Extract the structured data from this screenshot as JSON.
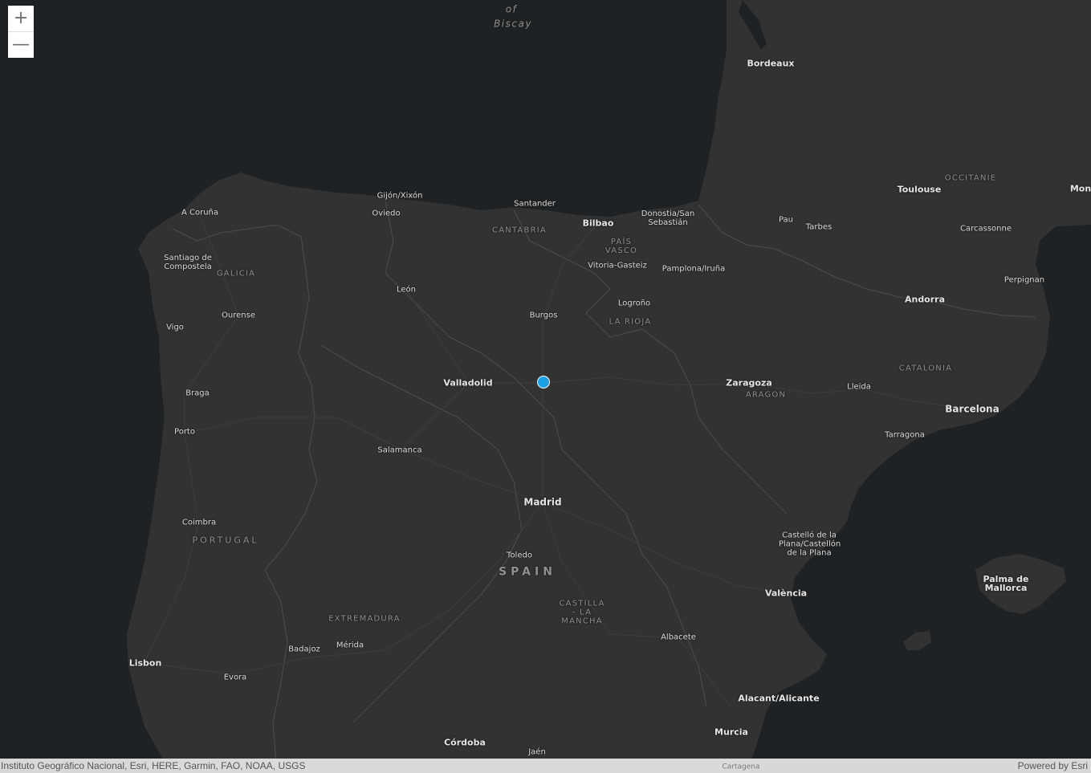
{
  "map": {
    "colors": {
      "water": "#1f2224",
      "land": "#323232",
      "border": "#4a4a4a",
      "road": "#3c3c3c",
      "marker": "#1aa0e3"
    },
    "controls": {
      "zoom_in": "+",
      "zoom_out": "—"
    },
    "attribution": "Instituto Geográfico Nacional, Esri, HERE, Garmin, FAO, NOAA, USGS",
    "powered_by": "Powered by Esri",
    "marker": {
      "icon": "location-point-icon"
    },
    "labels": {
      "bay_of": "of",
      "biscay": "Biscay",
      "bordeaux": "Bordeaux",
      "toulouse": "Toulouse",
      "occitanie": "OCCITANIE",
      "montpellier": "Mon",
      "pau": "Pau",
      "tarbes": "Tarbes",
      "carcassonne": "Carcassonne",
      "perpignan": "Perpignan",
      "andorra": "Andorra",
      "catalonia": "CATALONIA",
      "lleida": "Lleida",
      "barcelona": "Barcelona",
      "tarragona": "Tarragona",
      "gijon": "Gijón/Xixón",
      "oviedo": "Oviedo",
      "a_coruna": "A Coruña",
      "santander": "Santander",
      "cantabria": "CANTABRIA",
      "bilbao": "Bilbao",
      "donostia": "Donostia/San Sebastián",
      "pais_vasco": "PAÍS VASCO",
      "vitoria": "Vitoria-Gasteiz",
      "pamplona": "Pamplona/Iruña",
      "santiago": "Santiago de Compostela",
      "galicia": "GALICIA",
      "leon": "León",
      "ourense": "Ourense",
      "vigo": "Vigo",
      "burgos": "Burgos",
      "logrono": "Logroño",
      "la_rioja": "LA RIOJA",
      "valladolid": "Valladolid",
      "zaragoza": "Zaragoza",
      "aragon": "ARAGON",
      "braga": "Braga",
      "porto": "Porto",
      "salamanca": "Salamanca",
      "madrid": "Madrid",
      "coimbra": "Coimbra",
      "portugal": "PORTUGAL",
      "toledo": "Toledo",
      "spain": "SPAIN",
      "castello": "Castelló de la Plana/Castellón de la Plana",
      "palma": "Palma de Mallorca",
      "valencia": "València",
      "castilla": "CASTILLA - LA MANCHA",
      "extremadura": "EXTREMADURA",
      "albacete": "Albacete",
      "badajoz": "Badajoz",
      "merida": "Mérida",
      "lisbon": "Lisbon",
      "evora": "Evora",
      "alicante": "Alacant/Alicante",
      "murcia": "Murcia",
      "cordoba": "Córdoba",
      "jaen": "Jaén",
      "cartagena": "Cartagena"
    }
  }
}
